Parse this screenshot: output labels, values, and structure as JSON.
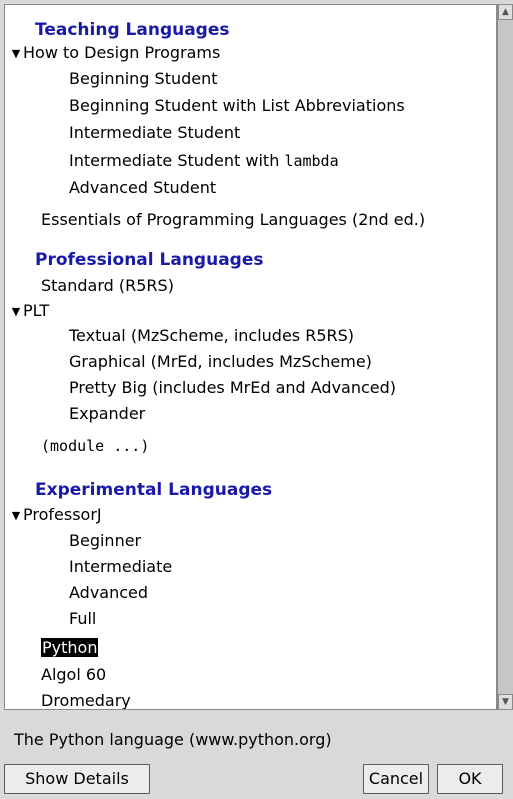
{
  "language_list": {
    "teaching_header": "Teaching Languages",
    "htdp_label": "How to Design Programs",
    "htdp_items": [
      "Beginning Student",
      "Beginning Student with List Abbreviations",
      "Intermediate Student",
      "Intermediate Student with",
      "Advanced Student"
    ],
    "lambda_word": "lambda",
    "eopl_label": "Essentials of Programming Languages (2nd ed.)",
    "professional_header": "Professional Languages",
    "standard_label": "Standard (R5RS)",
    "plt_label": "PLT",
    "plt_items": [
      "Textual (MzScheme, includes R5RS)",
      "Graphical (MrEd, includes MzScheme)",
      "Pretty Big (includes MrEd and Advanced)",
      "Expander"
    ],
    "module_label": "(module ...)",
    "experimental_header": "Experimental Languages",
    "professorj_label": "ProfessorJ",
    "professorj_items": [
      "Beginner",
      "Intermediate",
      "Advanced",
      "Full"
    ],
    "python_label": "Python",
    "algol_label": "Algol 60",
    "dromedary_label": "Dromedary",
    "selected_item": "Python"
  },
  "description": "The Python language (www.python.org)",
  "buttons": {
    "show_details": "Show Details",
    "cancel": "Cancel",
    "ok": "OK"
  },
  "icons": {
    "expand": "triangle-down-icon",
    "scroll_up": "scroll-up-arrow-icon",
    "scroll_down": "scroll-down-arrow-icon"
  },
  "colors": {
    "header": "#1a1aa8",
    "selection_bg": "#000000",
    "dialog_bg": "#d9d9d9"
  }
}
